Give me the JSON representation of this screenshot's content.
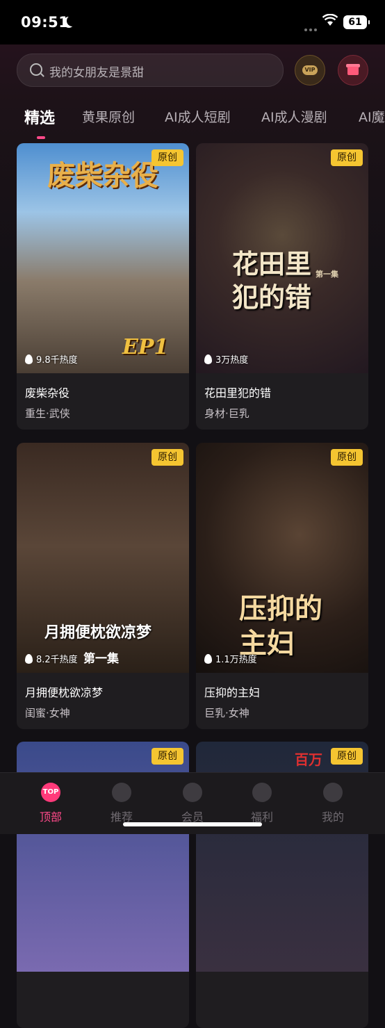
{
  "status_bar": {
    "time": "09:51",
    "battery": "61"
  },
  "search": {
    "placeholder": "我的女朋友是景甜"
  },
  "header": {
    "vip_badge": "VIP"
  },
  "tabs": [
    {
      "label": "精选"
    },
    {
      "label": "黄果原创"
    },
    {
      "label": "AI成人短剧"
    },
    {
      "label": "AI成人漫剧"
    },
    {
      "label": "AI魔"
    }
  ],
  "cards": [
    {
      "badge": "原创",
      "heat": "9.8千热度",
      "title": "废柴杂役",
      "tags": "重生·武侠",
      "poster_title": "废柴杂役",
      "poster_sub": "EP1"
    },
    {
      "badge": "原创",
      "heat": "3万热度",
      "title": "花田里犯的错",
      "tags": "身材·巨乳",
      "poster_title": "花田里犯的错",
      "poster_sub": "第一集"
    },
    {
      "badge": "原创",
      "heat": "8.2千热度",
      "title": "月拥便枕欲凉梦",
      "tags": "闺蜜·女神",
      "poster_title": "月拥便枕欲凉梦",
      "poster_sub": "第一集"
    },
    {
      "badge": "原创",
      "heat": "1.1万热度",
      "title": "压抑的主妇",
      "tags": "巨乳·女神",
      "poster_title": "压抑的主妇",
      "poster_sub": ""
    },
    {
      "badge": "原创"
    },
    {
      "badge": "原创",
      "poster_text": "百万"
    }
  ],
  "bottom_nav": [
    {
      "label": "顶部",
      "icon": "TOP"
    },
    {
      "label": "推荐"
    },
    {
      "label": "会员"
    },
    {
      "label": "福利"
    },
    {
      "label": "我的"
    }
  ]
}
